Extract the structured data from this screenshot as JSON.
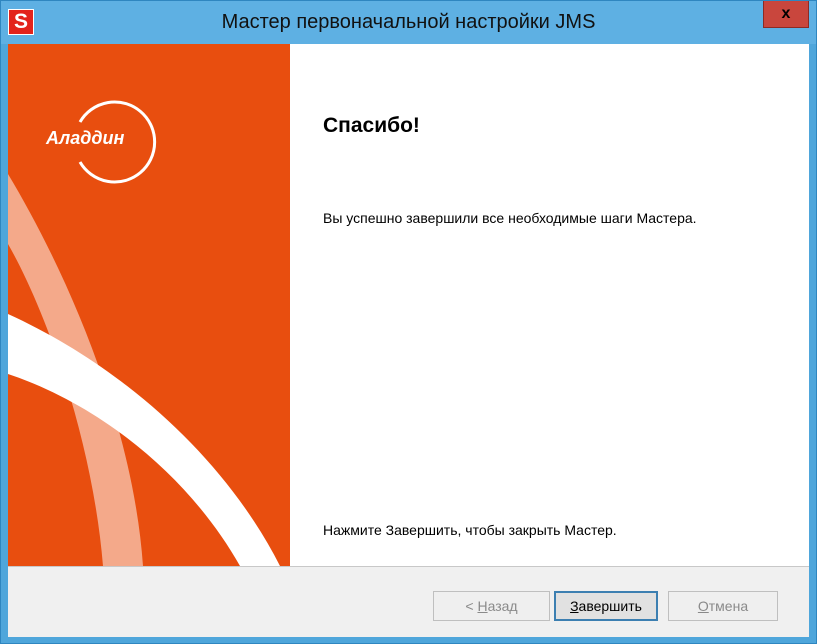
{
  "window": {
    "title": "Мастер первоначальной настройки JMS",
    "app_icon_letter": "S",
    "close_label": "x"
  },
  "side_panel": {
    "logo_text": "Аладдин",
    "colors": {
      "base": "#e84e0f",
      "light_band": "#f4a98a",
      "white_band": "#ffffff"
    }
  },
  "content": {
    "heading": "Спасибо!",
    "message": "Вы успешно завершили все необходимые шаги Мастера.",
    "hint": "Нажмите Завершить, чтобы закрыть Мастер."
  },
  "buttons": {
    "back": {
      "prefix": "< ",
      "accel": "Н",
      "rest": "азад",
      "enabled": false
    },
    "finish": {
      "accel": "З",
      "rest": "авершить",
      "enabled": true,
      "default": true
    },
    "cancel": {
      "accel": "О",
      "rest": "тмена",
      "enabled": false
    }
  }
}
